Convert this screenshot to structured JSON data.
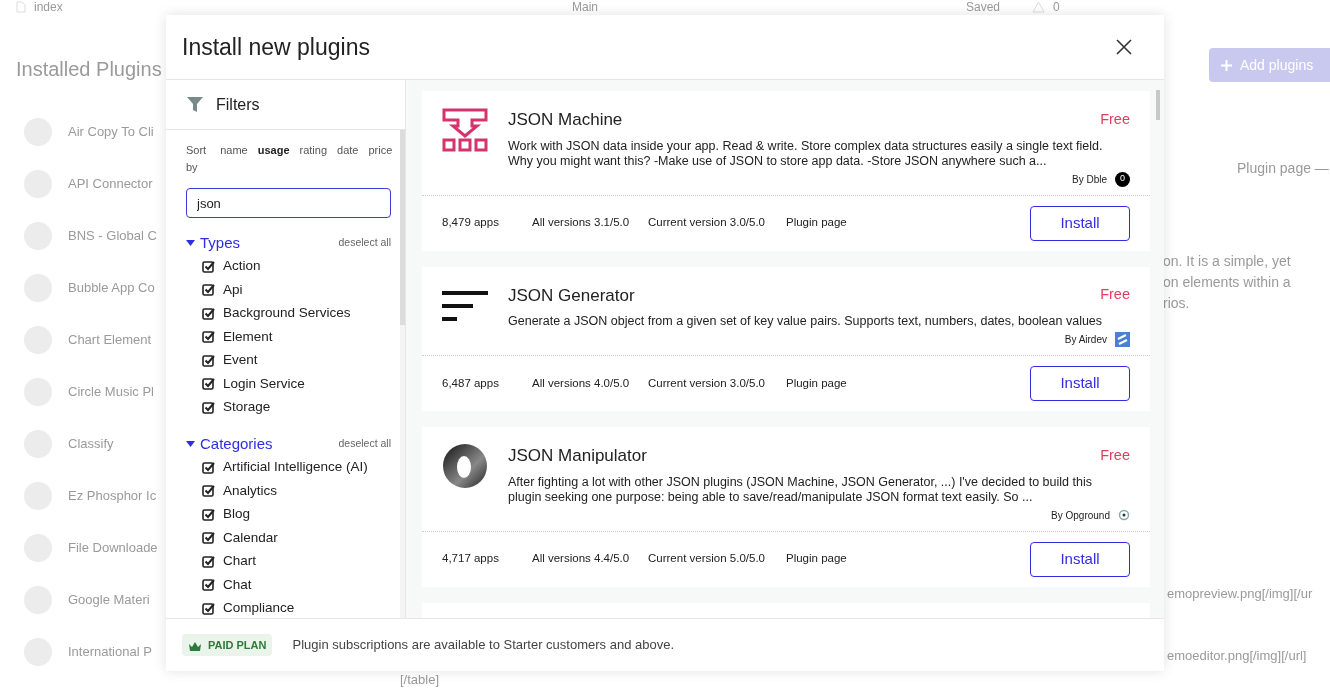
{
  "background": {
    "topbar": {
      "page": "index",
      "branch": "Main",
      "status": "Saved",
      "issues": "0"
    },
    "title": "Installed Plugins",
    "plugins": [
      "Air Copy To Cli",
      "API Connector",
      "BNS - Global C",
      "Bubble App Co",
      "Chart Element",
      "Circle Music Pl",
      "Classify",
      "Ez Phosphor Ic",
      "File Downloade",
      "Google Materi",
      "International P"
    ],
    "add_button": "Add plugins",
    "plugin_page": "Plugin page —",
    "description": [
      "on. It is a simple, yet",
      "on elements within a",
      "rios."
    ],
    "lines": [
      "emopreview.png[/img][/ur",
      "emoeditor.png[/img][/url]"
    ],
    "table_end": "[/table]"
  },
  "dialog": {
    "title": "Install new plugins",
    "filters": {
      "title": "Filters",
      "sort_label": "Sort by",
      "sort_options": [
        {
          "label": "name",
          "selected": false
        },
        {
          "label": "usage",
          "selected": true
        },
        {
          "label": "rating",
          "selected": false
        },
        {
          "label": "date",
          "selected": false
        },
        {
          "label": "price",
          "selected": false
        }
      ],
      "search": {
        "value": "json"
      },
      "groups": [
        {
          "title": "Types",
          "expanded": true,
          "action": "deselect all",
          "items": [
            {
              "label": "Action",
              "checked": true
            },
            {
              "label": "Api",
              "checked": true
            },
            {
              "label": "Background Services",
              "checked": true
            },
            {
              "label": "Element",
              "checked": true
            },
            {
              "label": "Event",
              "checked": true
            },
            {
              "label": "Login Service",
              "checked": true
            },
            {
              "label": "Storage",
              "checked": true
            }
          ]
        },
        {
          "title": "Categories",
          "expanded": true,
          "action": "deselect all",
          "items": [
            {
              "label": "Artificial Intelligence (AI)",
              "checked": true
            },
            {
              "label": "Analytics",
              "checked": true
            },
            {
              "label": "Blog",
              "checked": true
            },
            {
              "label": "Calendar",
              "checked": true
            },
            {
              "label": "Chart",
              "checked": true
            },
            {
              "label": "Chat",
              "checked": true
            },
            {
              "label": "Compliance",
              "checked": true
            }
          ]
        }
      ]
    },
    "results": [
      {
        "kind": "machine",
        "name": "JSON Machine",
        "price": "Free",
        "description": "Work with JSON data inside your app. Read & write. Store complex data structures easily a single text field. Why you might want this? -Make use of JSON to store app data. -Store JSON anywhere such a...",
        "author": {
          "name": "By Dble",
          "kind": "badge",
          "badge": "0"
        },
        "apps": "8,479 apps",
        "all_versions": "All versions 3.1/5.0",
        "current_version": "Current version 3.0/5.0",
        "link": "Plugin page",
        "button": "Install"
      },
      {
        "kind": "generator",
        "name": "JSON Generator",
        "price": "Free",
        "description": "Generate a JSON object from a given set of key value pairs. Supports text, numbers, dates, boolean values",
        "author": {
          "name": "By Airdev",
          "kind": "square"
        },
        "apps": "6,487 apps",
        "all_versions": "All versions 4.0/5.0",
        "current_version": "Current version 3.0/5.0",
        "link": "Plugin page",
        "button": "Install"
      },
      {
        "kind": "manipulator",
        "name": "JSON Manipulator",
        "price": "Free",
        "description": "After fighting a lot with other JSON plugins (JSON Machine, JSON Generator, ...) I've decided to build this plugin seeking one purpose: being able to save/read/manipulate JSON format text easily. So ...",
        "author": {
          "name": "By Opground",
          "kind": "logo"
        },
        "apps": "4,717 apps",
        "all_versions": "All versions 4.4/5.0",
        "current_version": "Current version 5.0/5.0",
        "link": "Plugin page",
        "button": "Install"
      }
    ],
    "footer": {
      "badge": "PAID PLAN",
      "note": "Plugin subscriptions are available to Starter customers and above."
    }
  }
}
